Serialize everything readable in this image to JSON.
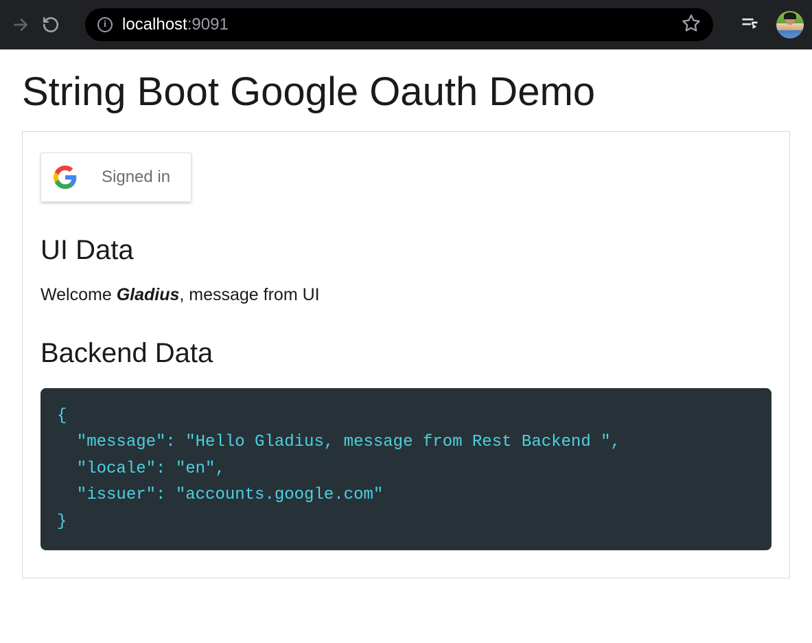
{
  "browser": {
    "url_host": "localhost",
    "url_port": ":9091"
  },
  "page": {
    "title": "String Boot Google Oauth Demo",
    "signin_label": "Signed in",
    "ui_data_heading": "UI Data",
    "welcome_prefix": "Welcome ",
    "welcome_name": "Gladius",
    "welcome_suffix": ", message from UI",
    "backend_heading": "Backend Data",
    "backend_json": "{\n  \"message\": \"Hello Gladius, message from Rest Backend \",\n  \"locale\": \"en\",\n  \"issuer\": \"accounts.google.com\"\n}"
  }
}
